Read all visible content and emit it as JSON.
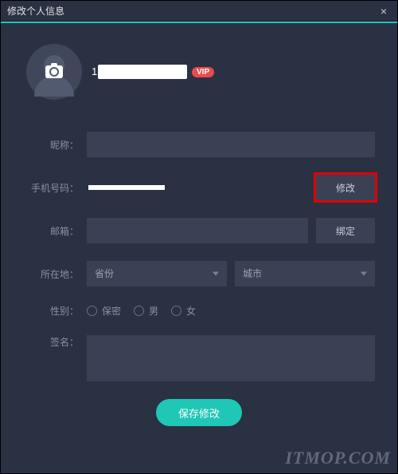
{
  "window": {
    "title": "修改个人信息",
    "close_label": "×"
  },
  "profile": {
    "username_masked": "　　　　　　　　",
    "vip_label": "VIP"
  },
  "form": {
    "nickname": {
      "label": "昵称：",
      "value": ""
    },
    "phone": {
      "label": "手机号码：",
      "value_masked": "＊＊＊＊＊＊＊＊＊＊＊",
      "action": "修改"
    },
    "email": {
      "label": "邮箱：",
      "value": "",
      "action": "绑定"
    },
    "location": {
      "label": "所在地：",
      "province_placeholder": "省份",
      "city_placeholder": "城市"
    },
    "gender": {
      "label": "性别：",
      "options": [
        "保密",
        "男",
        "女"
      ],
      "selected": null
    },
    "signature": {
      "label": "签名：",
      "value": ""
    },
    "save_label": "保存修改"
  },
  "watermark": "ITMOP.COM"
}
